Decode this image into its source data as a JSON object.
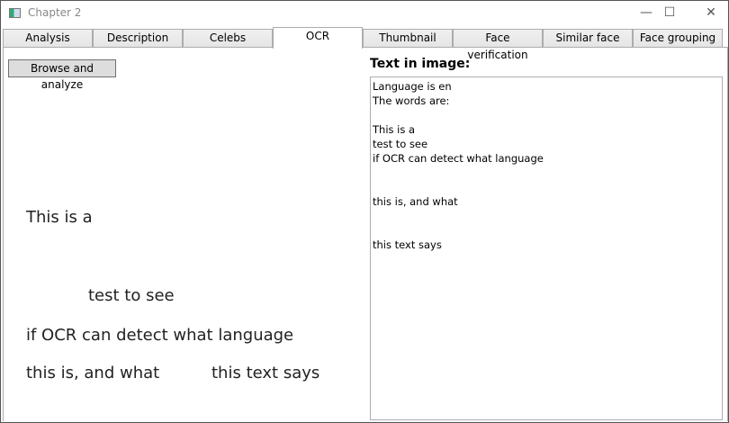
{
  "window": {
    "title": "Chapter 2",
    "controls": {
      "minimize": "—",
      "maximize": "☐",
      "close": "✕"
    }
  },
  "tabs": [
    {
      "label": "Analysis"
    },
    {
      "label": "Description"
    },
    {
      "label": "Celebs"
    },
    {
      "label": "OCR",
      "selected": true
    },
    {
      "label": "Thumbnail"
    },
    {
      "label": "Face verification"
    },
    {
      "label": "Similar face"
    },
    {
      "label": "Face grouping"
    }
  ],
  "ocr": {
    "browse_label": "Browse and analyze",
    "image_lines": [
      "This is a",
      "test to see",
      "if OCR can detect what language",
      "this is, and what",
      "this text says"
    ],
    "result_label": "Text in image:",
    "result_text": "Language is en\nThe words are:\n\nThis is a\ntest to see\nif OCR can detect what language\n\n\nthis is, and what\n\n\nthis text says"
  }
}
